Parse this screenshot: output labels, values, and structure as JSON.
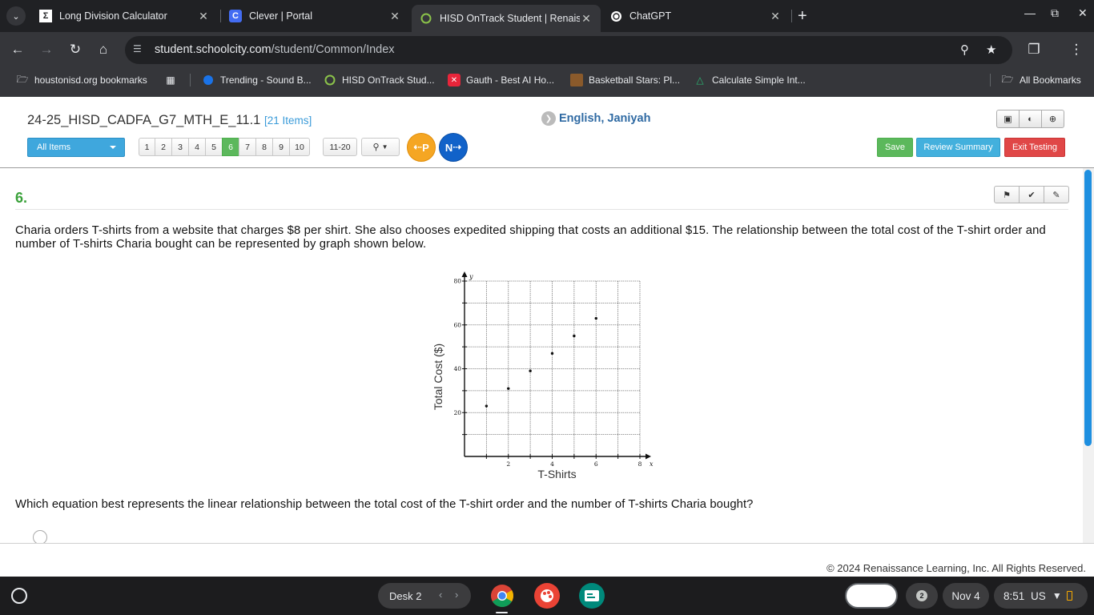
{
  "browser": {
    "tabs": [
      {
        "title": "Long Division Calculator",
        "favicon": "sigma-icon"
      },
      {
        "title": "Clever | Portal",
        "favicon": "clever-c-icon"
      },
      {
        "title": "HISD OnTrack Student | Renaissance",
        "favicon": "ring-icon"
      },
      {
        "title": "ChatGPT",
        "favicon": "openai-icon"
      }
    ],
    "url": {
      "host": "student.schoolcity.com",
      "path": "/student/Common/Index"
    },
    "bookmarks": [
      {
        "label": "houstonisd.org bookmarks"
      },
      {
        "label": "Trending - Sound B..."
      },
      {
        "label": "HISD OnTrack Stud..."
      },
      {
        "label": "Gauth - Best AI Ho..."
      },
      {
        "label": "Basketball Stars: Pl..."
      },
      {
        "label": "Calculate Simple Int..."
      }
    ],
    "all_bookmarks": "All Bookmarks"
  },
  "assessment": {
    "title": "24-25_HISD_CADFA_G7_MTH_E_11.1",
    "item_count": "[21 Items]",
    "student_name": "English, Janiyah",
    "filter_label": "All Items",
    "pages": [
      "1",
      "2",
      "3",
      "4",
      "5",
      "6",
      "7",
      "8",
      "9",
      "10"
    ],
    "current_page": "6",
    "range_label": "11-20",
    "prev_label": "P",
    "next_label": "N",
    "save_label": "Save",
    "review_label": "Review Summary",
    "exit_label": "Exit Testing"
  },
  "question": {
    "number": "6.",
    "text": "Charia orders T-shirts from a website that charges $8 per shirt.  She also chooses expedited shipping that costs an additional $15. The relationship between the total cost of the T-shirt order and number of T-shirts Charia bought can be represented by graph shown below.",
    "prompt": "Which equation best represents the linear relationship between the total cost of the T-shirt order and the number of T-shirts Charia bought?"
  },
  "chart_data": {
    "type": "scatter",
    "xlabel": "T-Shirts",
    "ylabel": "Total Cost ($)",
    "x_axis_letter": "x",
    "y_axis_letter": "y",
    "xlim": [
      0,
      8
    ],
    "ylim": [
      0,
      80
    ],
    "x_ticks": [
      2,
      4,
      6,
      8
    ],
    "y_ticks": [
      20,
      40,
      60,
      80
    ],
    "grid": true,
    "points": [
      {
        "x": 1,
        "y": 23
      },
      {
        "x": 2,
        "y": 31
      },
      {
        "x": 3,
        "y": 39
      },
      {
        "x": 4,
        "y": 47
      },
      {
        "x": 5,
        "y": 55
      },
      {
        "x": 6,
        "y": 63
      }
    ]
  },
  "footer": {
    "copyright": "© 2024 Renaissance Learning, Inc. All Rights Reserved."
  },
  "shelf": {
    "desk_label": "Desk 2",
    "notification_count": "2",
    "date": "Nov 4",
    "time": "8:51",
    "locale": "US"
  }
}
